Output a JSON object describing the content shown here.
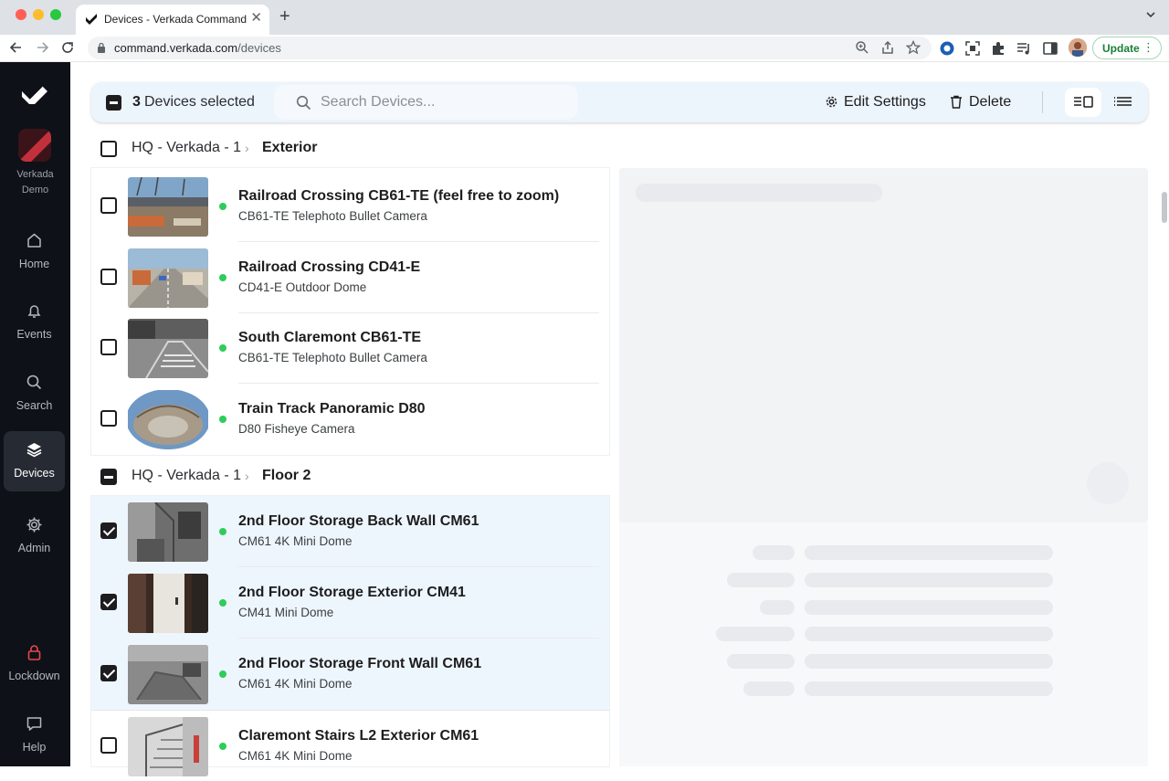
{
  "browser": {
    "tab_title": "Devices - Verkada Command",
    "url_host": "command.verkada.com",
    "url_path": "/devices",
    "update_label": "Update"
  },
  "sidebar": {
    "org_name_line1": "Verkada",
    "org_name_line2": "Demo",
    "items": [
      {
        "label": "Home",
        "icon": "home-icon"
      },
      {
        "label": "Events",
        "icon": "bell-icon"
      },
      {
        "label": "Search",
        "icon": "search-icon"
      },
      {
        "label": "Devices",
        "icon": "devices-icon"
      },
      {
        "label": "Admin",
        "icon": "gear-icon"
      },
      {
        "label": "Lockdown",
        "icon": "lock-icon"
      },
      {
        "label": "Help",
        "icon": "chat-icon"
      }
    ]
  },
  "actionbar": {
    "selected_count": "3",
    "selected_text": "Devices selected",
    "search_placeholder": "Search Devices...",
    "edit_label": "Edit Settings",
    "delete_label": "Delete"
  },
  "groups": [
    {
      "site": "HQ - Verkada - 1",
      "area": "Exterior",
      "state": "unchecked"
    },
    {
      "site": "HQ - Verkada - 1",
      "area": "Floor 2",
      "state": "indeterminate"
    }
  ],
  "devices": [
    {
      "name": "Railroad Crossing CB61-TE (feel free to zoom)",
      "model": "CB61-TE Telephoto Bullet Camera",
      "selected": false
    },
    {
      "name": "Railroad Crossing CD41-E",
      "model": "CD41-E Outdoor Dome",
      "selected": false
    },
    {
      "name": "South Claremont CB61-TE",
      "model": "CB61-TE Telephoto Bullet Camera",
      "selected": false
    },
    {
      "name": "Train Track Panoramic D80",
      "model": "D80 Fisheye Camera",
      "selected": false
    },
    {
      "name": "2nd Floor Storage Back Wall CM61",
      "model": "CM61 4K Mini Dome",
      "selected": true
    },
    {
      "name": "2nd Floor Storage Exterior CM41",
      "model": "CM41 Mini Dome",
      "selected": true
    },
    {
      "name": "2nd Floor Storage Front Wall CM61",
      "model": "CM61 4K Mini Dome",
      "selected": true
    },
    {
      "name": "Claremont Stairs L2 Exterior CM61",
      "model": "CM61 4K Mini Dome",
      "selected": false
    }
  ],
  "colors": {
    "sidebar_bg": "#0e1117",
    "status_online": "#2ecc5a",
    "actionbar_bg": "#ecf4fc",
    "selected_row_bg": "#eef6fd"
  }
}
